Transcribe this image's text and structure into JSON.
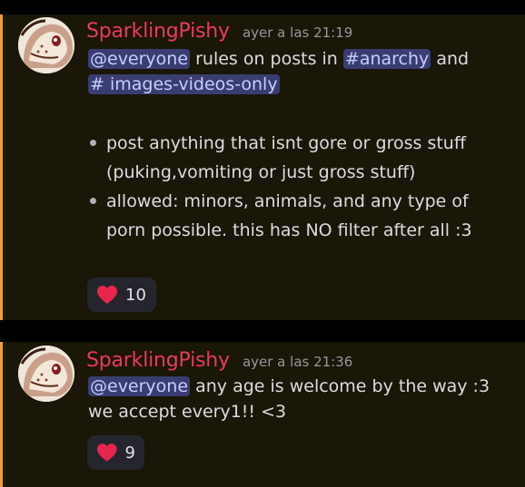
{
  "messages": [
    {
      "username": "SparklingPishy",
      "timestamp": "ayer a las 21:19",
      "mention": "@everyone",
      "text1": "rules on posts in",
      "channel1": "#anarchy",
      "text2": "and",
      "channel2": "# images-videos-only",
      "bullets": [
        "post anything that isnt gore or gross stuff (puking,vomiting or just gross stuff)",
        "allowed: minors, animals, and any type of porn possible. this has NO filter after all :3"
      ],
      "reaction": {
        "icon": "heart-icon",
        "count": "10"
      }
    },
    {
      "username": "SparklingPishy",
      "timestamp": "ayer a las 21:36",
      "mention": "@everyone",
      "text1": "any age is welcome by the way :3",
      "line2": "we accept every1!! <3",
      "reaction": {
        "icon": "heart-icon",
        "count": "9"
      }
    }
  ],
  "colors": {
    "username": "#ec3a5a",
    "accent_border": "#e8a528",
    "mention_bg": "#3a3d72",
    "heart": "#e8264d"
  }
}
